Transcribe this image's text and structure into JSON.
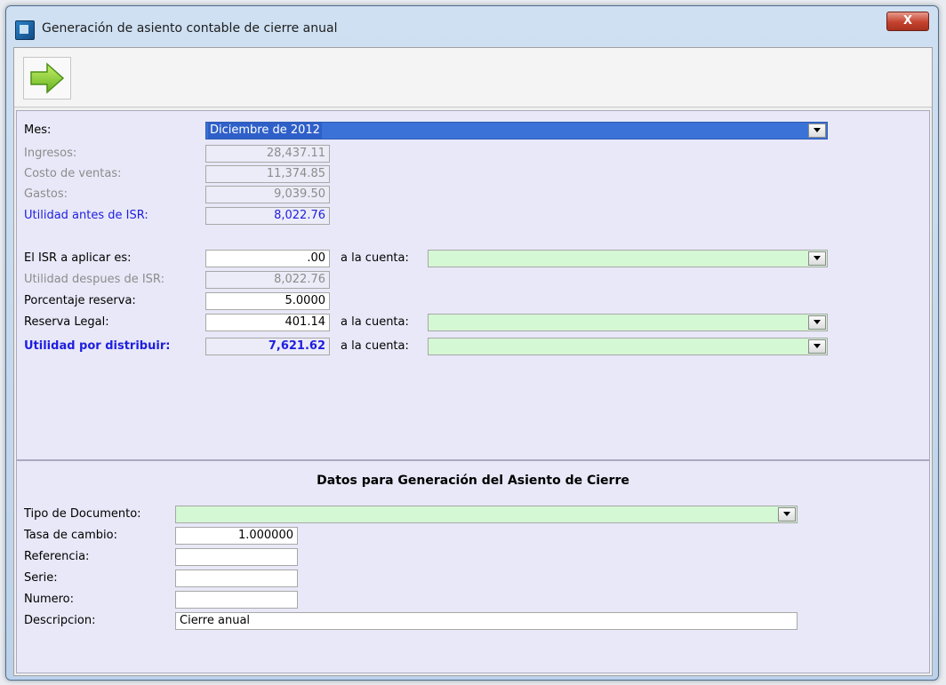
{
  "window": {
    "title": "Generación de asiento contable de cierre anual",
    "close_glyph": "X"
  },
  "toolbar": {
    "go_icon": "green-right-arrow"
  },
  "summary": {
    "mes_label": "Mes:",
    "mes_value": "Diciembre de 2012",
    "ingresos_label": "Ingresos:",
    "ingresos_value": "28,437.11",
    "costo_label": "Costo de ventas:",
    "costo_value": "11,374.85",
    "gastos_label": "Gastos:",
    "gastos_value": "9,039.50",
    "utilidad_antes_label": "Utilidad antes de ISR:",
    "utilidad_antes_value": "8,022.76",
    "isr_label": "El ISR a aplicar es:",
    "isr_value": ".00",
    "isr_cuenta_label": "a la cuenta:",
    "utilidad_despues_label": "Utilidad despues de ISR:",
    "utilidad_despues_value": "8,022.76",
    "porcentaje_label": "Porcentaje reserva:",
    "porcentaje_value": "5.0000",
    "reserva_label": "Reserva Legal:",
    "reserva_value": "401.14",
    "reserva_cuenta_label": "a la cuenta:",
    "distribuir_label": "Utilidad por distribuir:",
    "distribuir_value": "7,621.62",
    "distribuir_cuenta_label": "a la cuenta:"
  },
  "asiento": {
    "title": "Datos para Generación del Asiento de Cierre",
    "tipo_label": "Tipo de Documento:",
    "tasa_label": "Tasa de cambio:",
    "tasa_value": "1.000000",
    "referencia_label": "Referencia:",
    "referencia_value": "",
    "serie_label": "Serie:",
    "serie_value": "",
    "numero_label": "Numero:",
    "numero_value": "",
    "descripcion_label": "Descripcion:",
    "descripcion_value": "Cierre anual"
  },
  "colors": {
    "panel_bg": "#e8e8f8",
    "account_combo_bg": "#d4f7d4",
    "highlight_blue": "#1e1ee0"
  }
}
